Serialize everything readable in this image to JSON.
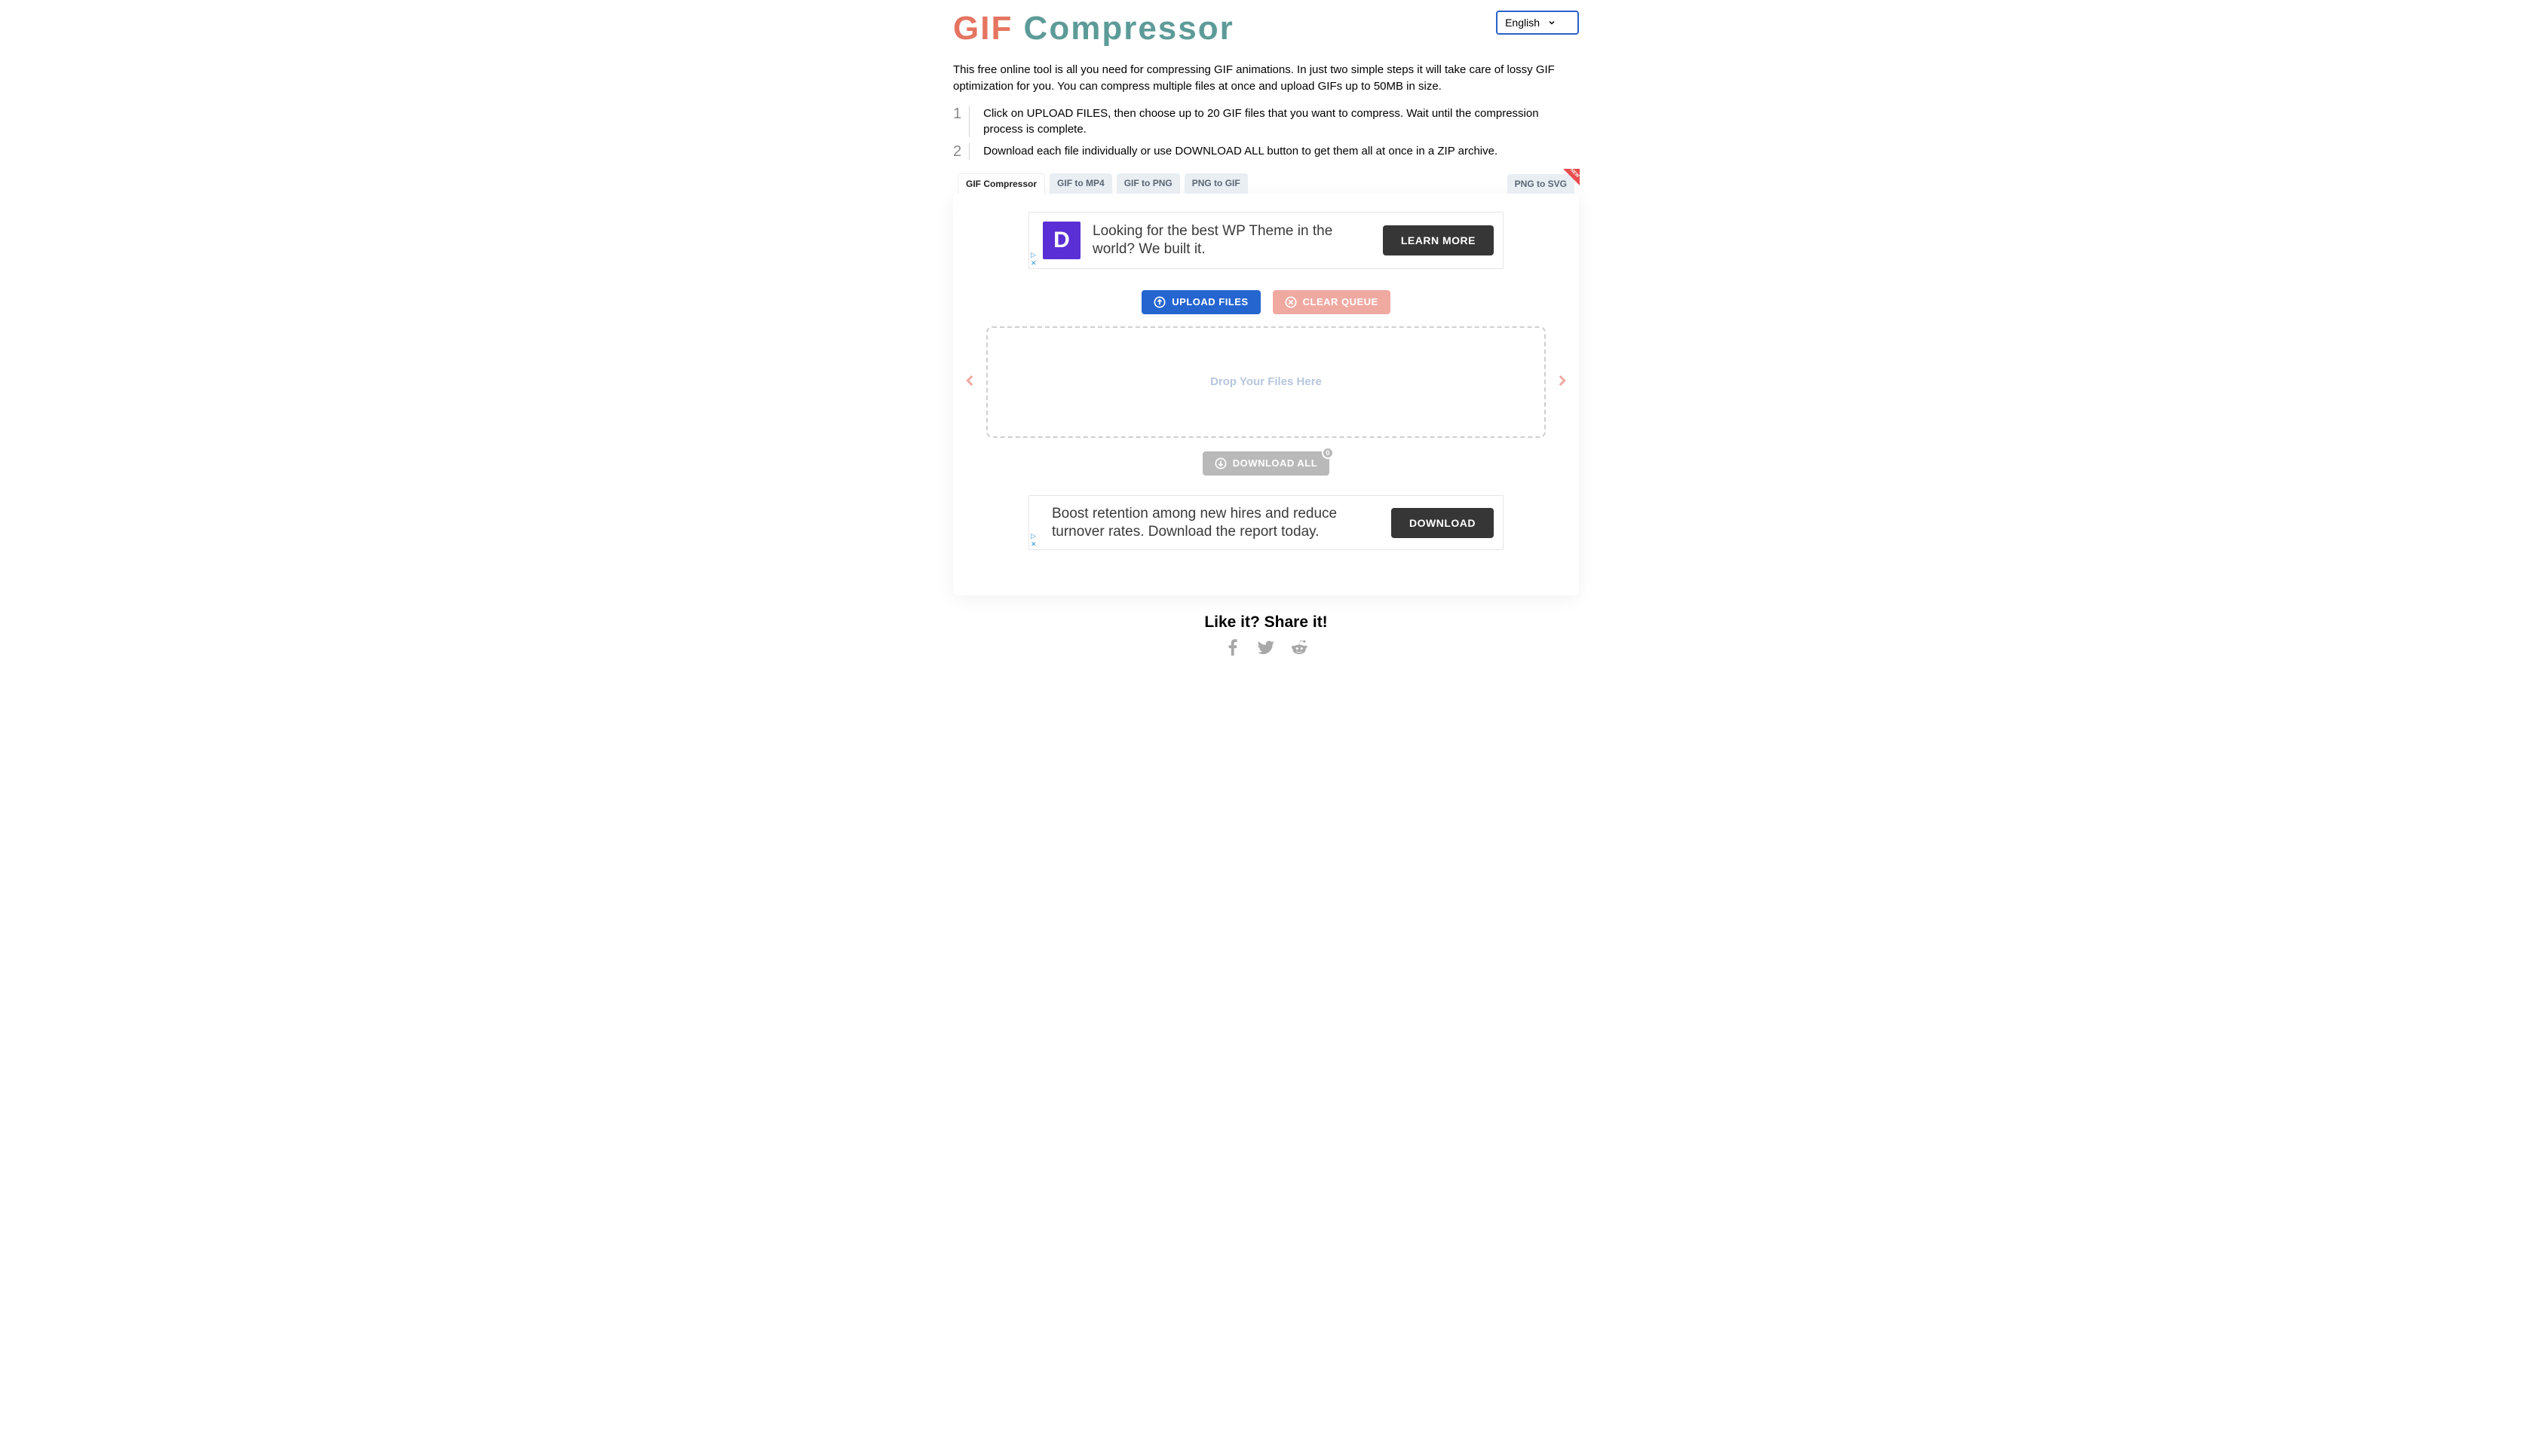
{
  "logo": {
    "part1": "GIF",
    "part2": " Compressor"
  },
  "language": {
    "selected": "English"
  },
  "intro": "This free online tool is all you need for compressing GIF animations. In just two simple steps it will take care of lossy GIF optimization for you. You can compress multiple files at once and upload GIFs up to 50MB in size.",
  "steps": [
    {
      "num": "1",
      "text": "Click on UPLOAD FILES, then choose up to 20 GIF files that you want to compress. Wait until the compression process is complete."
    },
    {
      "num": "2",
      "text": "Download each file individually or use DOWNLOAD ALL button to get them all at once in a ZIP archive."
    }
  ],
  "tabs": {
    "left": [
      {
        "label": "GIF Compressor",
        "active": true
      },
      {
        "label": "GIF to MP4",
        "active": false
      },
      {
        "label": "GIF to PNG",
        "active": false
      },
      {
        "label": "PNG to GIF",
        "active": false
      }
    ],
    "right": [
      {
        "label": "PNG to SVG",
        "corner": "NEW"
      }
    ]
  },
  "ads": {
    "top": {
      "logo_letter": "D",
      "text": "Looking for the best WP Theme in the world? We built it.",
      "cta": "LEARN MORE"
    },
    "bottom": {
      "text": "Boost retention among new hires and reduce turnover rates. Download the report today.",
      "cta": "DOWNLOAD"
    }
  },
  "buttons": {
    "upload": "UPLOAD FILES",
    "clear": "CLEAR QUEUE",
    "download_all": "DOWNLOAD ALL",
    "download_count": "0"
  },
  "dropzone": {
    "placeholder": "Drop Your Files Here"
  },
  "share": {
    "heading": "Like it? Share it!"
  }
}
